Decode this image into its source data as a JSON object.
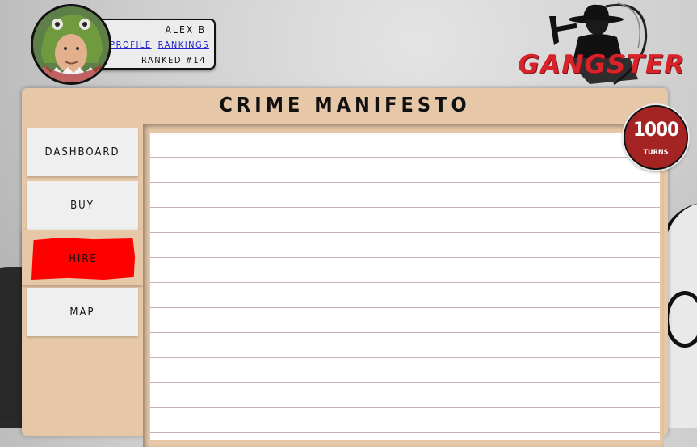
{
  "user": {
    "name": "ALEX B",
    "profile_link": "PROFILE",
    "rankings_link": "RANKINGS",
    "rank": "RANKED #14"
  },
  "logo": {
    "text": "GANGSTER",
    "color": "#d8232a"
  },
  "panel": {
    "title": "CRIME MANIFESTO",
    "background": "#e6c7a8"
  },
  "nav": {
    "items": [
      {
        "label": "DASHBOARD"
      },
      {
        "label": "BUY"
      },
      {
        "label": "HIRE",
        "active": true
      },
      {
        "label": "MAP"
      }
    ],
    "active_color": "#fe0000"
  },
  "turns": {
    "value": "1000",
    "label": "TURNS",
    "color": "#a42424"
  }
}
